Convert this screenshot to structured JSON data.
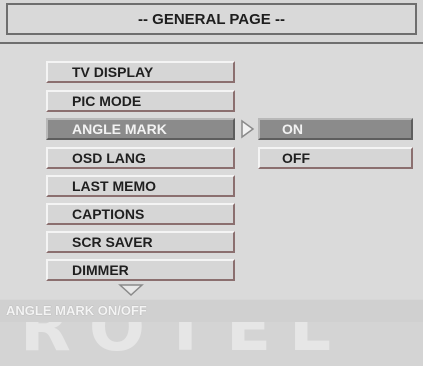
{
  "header": {
    "title": "-- GENERAL PAGE --"
  },
  "menu": {
    "items": [
      {
        "label": "TV DISPLAY",
        "selected": false
      },
      {
        "label": "PIC MODE",
        "selected": false
      },
      {
        "label": "ANGLE MARK",
        "selected": true
      },
      {
        "label": "OSD LANG",
        "selected": false
      },
      {
        "label": "LAST MEMO",
        "selected": false
      },
      {
        "label": "CAPTIONS",
        "selected": false
      },
      {
        "label": "SCR SAVER",
        "selected": false
      },
      {
        "label": "DIMMER",
        "selected": false
      }
    ]
  },
  "submenu": {
    "items": [
      {
        "label": "ON",
        "selected": true
      },
      {
        "label": "OFF",
        "selected": false
      }
    ]
  },
  "watermark": {
    "text": "ROTEL"
  },
  "status": {
    "text": "ANGLE MARK ON/OFF"
  },
  "colors": {
    "background": "#d7d7d7",
    "selected": "#8b8b8b",
    "text": "#1f1f1f"
  }
}
